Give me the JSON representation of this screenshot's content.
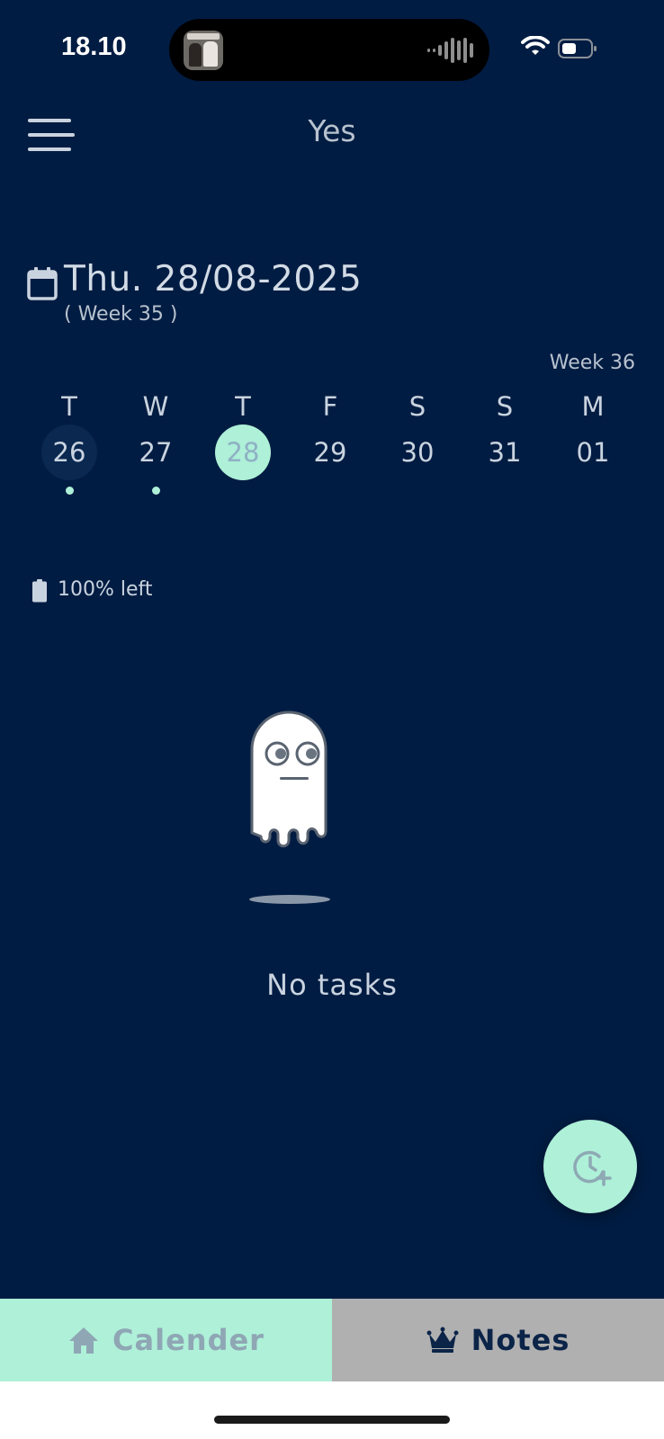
{
  "status_bar": {
    "time": "18.10",
    "icons": [
      "now-playing-thumbnail",
      "audio-waveform-icon",
      "wifi-icon",
      "battery-icon"
    ]
  },
  "header": {
    "menu_icon": "hamburger-menu-icon",
    "title": "Yes"
  },
  "date_header": {
    "icon": "calendar-icon",
    "date": "Thu. 28/08-2025",
    "week": "( Week 35 )"
  },
  "week_strip": {
    "next_week_label": "Week 36",
    "days": [
      {
        "name": "T",
        "num": "26",
        "has_tasks": true,
        "today": true,
        "selected": false
      },
      {
        "name": "W",
        "num": "27",
        "has_tasks": true,
        "today": false,
        "selected": false
      },
      {
        "name": "T",
        "num": "28",
        "has_tasks": false,
        "today": false,
        "selected": true
      },
      {
        "name": "F",
        "num": "29",
        "has_tasks": false,
        "today": false,
        "selected": false
      },
      {
        "name": "S",
        "num": "30",
        "has_tasks": false,
        "today": false,
        "selected": false
      },
      {
        "name": "S",
        "num": "31",
        "has_tasks": false,
        "today": false,
        "selected": false
      },
      {
        "name": "M",
        "num": "01",
        "has_tasks": false,
        "today": false,
        "selected": false
      }
    ]
  },
  "capacity": {
    "icon": "battery-full-icon",
    "text": "100% left",
    "fraction": 1.0
  },
  "empty_state": {
    "illustration": "ghost-illustration",
    "text": "No tasks"
  },
  "fab": {
    "icon": "clock-plus-icon"
  },
  "tabs": [
    {
      "label": "Calender",
      "icon": "home-icon",
      "active": true
    },
    {
      "label": "Notes",
      "icon": "crown-icon",
      "active": false
    }
  ],
  "colors": {
    "background": "#011c42",
    "accent": "#aef0d8",
    "inactive_tab": "#b0b0b0"
  }
}
